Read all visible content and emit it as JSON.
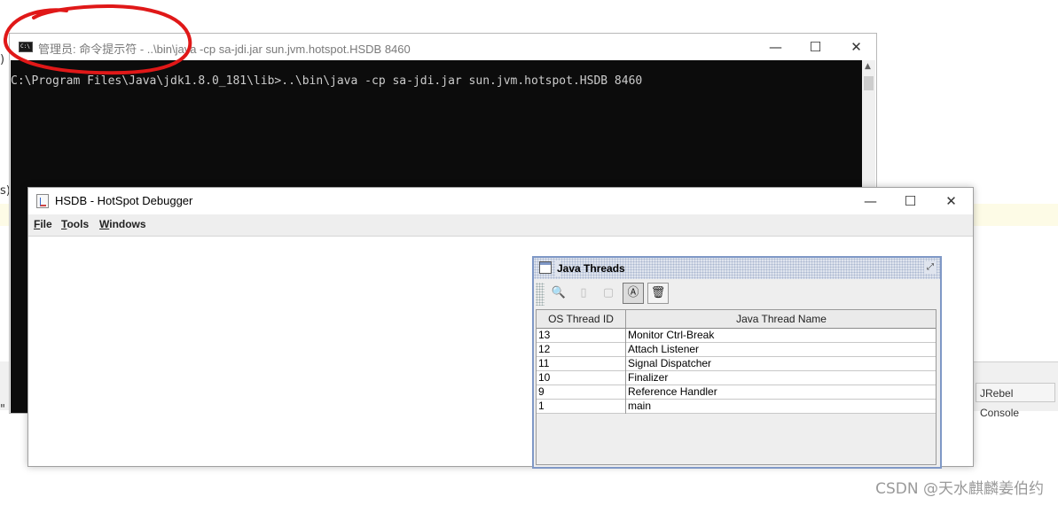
{
  "cmd_window": {
    "title": "管理员: 命令提示符 - ..\\bin\\java -cp sa-jdi.jar sun.jvm.hotspot.HSDB 8460",
    "icon_label": "C:\\",
    "command_line": "C:\\Program Files\\Java\\jdk1.8.0_181\\lib>..\\bin\\java -cp sa-jdi.jar sun.jvm.hotspot.HSDB 8460",
    "controls": {
      "minimize": "—",
      "maximize": "☐",
      "close": "✕"
    }
  },
  "hsdb_window": {
    "title": "HSDB - HotSpot Debugger",
    "controls": {
      "minimize": "—",
      "maximize": "☐",
      "close": "✕"
    },
    "menu": [
      {
        "label": "File",
        "mnemonic": "F",
        "rest": "ile"
      },
      {
        "label": "Tools",
        "mnemonic": "T",
        "rest": "ools"
      },
      {
        "label": "Windows",
        "mnemonic": "W",
        "rest": "indows"
      }
    ]
  },
  "java_threads_frame": {
    "title": "Java Threads",
    "toolbar": [
      {
        "icon": "inspect-icon",
        "glyph": "🔍",
        "enabled": false
      },
      {
        "icon": "stack-icon",
        "glyph": "▯",
        "enabled": false
      },
      {
        "icon": "memory-icon",
        "glyph": "▢",
        "enabled": false
      },
      {
        "icon": "find-crashes-icon",
        "glyph": "Ⓐ",
        "enabled": true
      },
      {
        "icon": "trash-icon",
        "glyph": "🗑",
        "enabled": true
      }
    ],
    "columns": [
      "OS Thread ID",
      "Java Thread Name"
    ],
    "rows": [
      {
        "id": "13",
        "name": "Monitor Ctrl-Break"
      },
      {
        "id": "12",
        "name": "Attach Listener"
      },
      {
        "id": "11",
        "name": "Signal Dispatcher"
      },
      {
        "id": "10",
        "name": "Finalizer"
      },
      {
        "id": "9",
        "name": "Reference Handler"
      },
      {
        "id": "1",
        "name": "main"
      }
    ]
  },
  "background": {
    "jrebel_tab": "JRebel Console",
    "left_marks": [
      ")",
      "s)",
      "\""
    ]
  },
  "watermark": "CSDN @天水麒麟姜伯约",
  "colors": {
    "cmd_background": "#0c0c0c",
    "cmd_text": "#cccccc",
    "frame_border": "#7f98c6",
    "annotation_red": "#e01818"
  }
}
